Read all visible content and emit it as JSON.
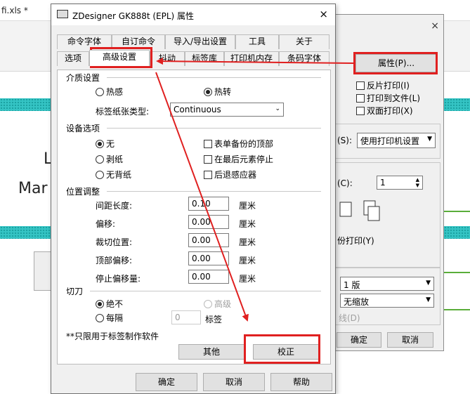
{
  "background": {
    "file_title": "fi.xls *",
    "big_text_1": "L",
    "big_text_2": "Mar"
  },
  "print_dialog": {
    "properties_button": "属性(P)...",
    "checkboxes": [
      "反片打印(I)",
      "打印到文件(L)",
      "双面打印(X)"
    ],
    "paper_source_label": "(S):",
    "paper_source_value": "使用打印机设置",
    "copies_label": "(C):",
    "copies_value": "1",
    "collate_label": "份打印(Y)",
    "pages_value": "1 版",
    "scale_value": "无缩放",
    "line_label": "线(D)",
    "ok": "确定",
    "cancel": "取消",
    "close_glyph": "×"
  },
  "dialog": {
    "title": "ZDesigner GK888t (EPL) 属性",
    "close_glyph": "×",
    "tabs_row1": [
      "命令字体",
      "自订命令",
      "导入/导出设置",
      "工具",
      "关于"
    ],
    "tabs_row2": [
      "选项",
      "高级设置",
      "抖动",
      "标签库",
      "打印机内存",
      "条码字体"
    ],
    "selected_tab": "高级设置",
    "media": {
      "section": "介质设置",
      "thermal": "热感",
      "thermal_transfer": "热转",
      "paper_type_label": "标签纸张类型:",
      "paper_type_value": "Continuous"
    },
    "device": {
      "section": "设备选项",
      "none": "无",
      "peel": "剥纸",
      "no_liner": "无背纸",
      "cb_form_backup": "表单备份的顶部",
      "cb_stop_last": "在最后元素停止",
      "cb_back_sensor": "后退感应器"
    },
    "position": {
      "section": "位置调整",
      "rows": [
        {
          "label": "间距长度:",
          "value": "0.10",
          "unit": "厘米"
        },
        {
          "label": "偏移:",
          "value": "0.00",
          "unit": "厘米"
        },
        {
          "label": "裁切位置:",
          "value": "0.00",
          "unit": "厘米"
        },
        {
          "label": "顶部偏移:",
          "value": "0.00",
          "unit": "厘米"
        },
        {
          "label": "停止偏移量:",
          "value": "0.00",
          "unit": "厘米"
        }
      ]
    },
    "cutter": {
      "section": "切刀",
      "never": "绝不",
      "every": "每隔",
      "advanced": "高级",
      "count_value": "0",
      "count_unit": "标签"
    },
    "note": "**只限用于标签制作软件",
    "other_button": "其他",
    "calibrate_button": "校正",
    "ok": "确定",
    "cancel": "取消",
    "help": "帮助"
  },
  "colors": {
    "annotation_red": "#e02020",
    "stripe": "#35c4c4"
  }
}
